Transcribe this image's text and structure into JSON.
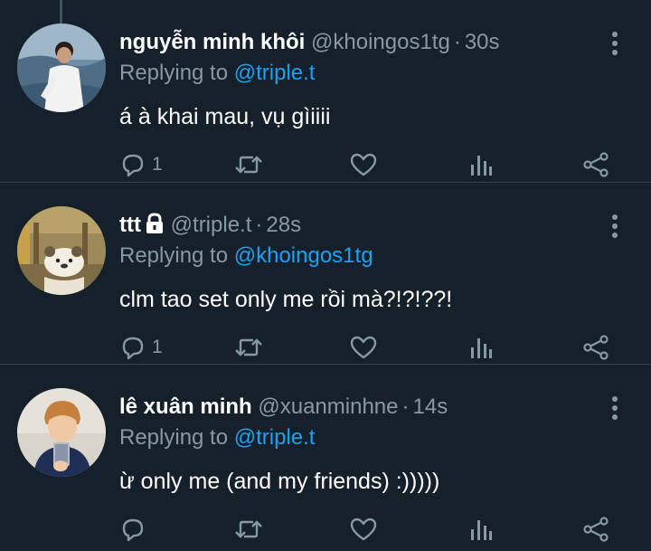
{
  "colors": {
    "background": "#15202b",
    "text": "#ffffff",
    "muted": "#8899a6",
    "link": "#1da1f2",
    "divider": "#38444d"
  },
  "tweets": [
    {
      "name": "nguyễn minh khôi",
      "handle": "@khoingos1tg",
      "separator": "·",
      "time": "30s",
      "replying_prefix": "Replying to",
      "replying_to": "@triple.t",
      "text": "á à khai mau, vụ gìiiii",
      "reply_count": "1",
      "locked": false
    },
    {
      "name": "ttt",
      "handle": "@triple.t",
      "separator": "·",
      "time": "28s",
      "replying_prefix": "Replying to",
      "replying_to": "@khoingos1tg",
      "text": "clm tao set only me rồi mà?!?!??!",
      "reply_count": "1",
      "locked": true
    },
    {
      "name": "lê xuân minh",
      "handle": "@xuanminhne",
      "separator": "·",
      "time": "14s",
      "replying_prefix": "Replying to",
      "replying_to": "@triple.t",
      "text": "ừ only me (and my friends) :)))))",
      "reply_count": "",
      "locked": false
    }
  ],
  "icons": [
    "reply-icon",
    "retweet-icon",
    "like-icon",
    "analytics-icon",
    "share-icon",
    "more-options-icon",
    "lock-icon"
  ]
}
